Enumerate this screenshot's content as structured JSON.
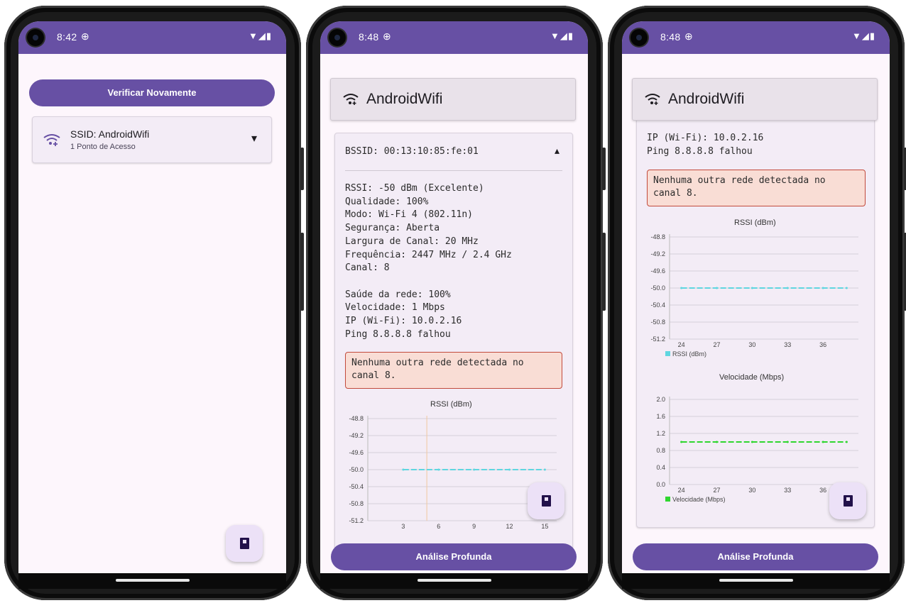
{
  "status": {
    "s1_time": "8:42",
    "s2_time": "8:48",
    "s3_time": "8:48",
    "sync_glyph": "⊕",
    "system_icons": "▼◢▮"
  },
  "screen1": {
    "check_again_label": "Verificar Novamente",
    "ssid_label": "SSID: AndroidWifi",
    "ap_count": "1 Ponto de Acesso",
    "expand_glyph": "▾"
  },
  "detail": {
    "network_name": "AndroidWifi",
    "bssid": "BSSID: 00:13:10:85:fe:01",
    "collapse_glyph": "▴",
    "rssi": "RSSI: -50 dBm (Excelente)",
    "quality": "Qualidade: 100%",
    "mode": "Modo: Wi-Fi 4 (802.11n)",
    "security": "Segurança: Aberta",
    "channel_width": "Largura de Canal: 20 MHz",
    "frequency": "Frequência: 2447 MHz / 2.4 GHz",
    "channel": "Canal: 8",
    "health": "Saúde da rede: 100%",
    "speed": "Velocidade: 1 Mbps",
    "ip": "IP (Wi-Fi): 10.0.2.16",
    "ping": "Ping 8.8.8.8 falhou",
    "alert_line1": "Nenhuma outra rede detectada no",
    "alert_line2": "canal 8.",
    "deep_analysis_label": "Análise Profunda"
  },
  "chart_data": [
    {
      "type": "line",
      "title": "RSSI (dBm)",
      "x": [
        3,
        6,
        9,
        12,
        15
      ],
      "x_ticks": [
        "3",
        "6",
        "9",
        "12",
        "15"
      ],
      "y_ticks": [
        "-48.8",
        "-49.2",
        "-49.6",
        "-50.0",
        "-50.4",
        "-50.8",
        "-51.2"
      ],
      "ylim": [
        -51.2,
        -48.8
      ],
      "series": [
        {
          "values": [
            -50.0,
            -50.0,
            -50.0,
            -50.0,
            -50.0
          ],
          "color": "#5fd6e0"
        }
      ],
      "marker_line_x": 5
    },
    {
      "type": "line",
      "title": "RSSI (dBm)",
      "x": [
        24,
        27,
        30,
        33,
        36,
        38
      ],
      "x_ticks": [
        "24",
        "27",
        "30",
        "33",
        "36"
      ],
      "y_ticks": [
        "-48.8",
        "-49.2",
        "-49.6",
        "-50.0",
        "-50.4",
        "-50.8",
        "-51.2"
      ],
      "ylim": [
        -51.2,
        -48.8
      ],
      "series": [
        {
          "name": "RSSI (dBm)",
          "values": [
            -50.0,
            -50.0,
            -50.0,
            -50.0,
            -50.0,
            -50.0
          ],
          "color": "#5fd6e0"
        }
      ]
    },
    {
      "type": "line",
      "title": "Velocidade (Mbps)",
      "x": [
        24,
        27,
        30,
        33,
        36,
        38
      ],
      "x_ticks": [
        "24",
        "27",
        "30",
        "33",
        "36"
      ],
      "y_ticks": [
        "2.0",
        "1.6",
        "1.2",
        "0.8",
        "0.4",
        "0.0"
      ],
      "ylim": [
        0.0,
        2.0
      ],
      "series": [
        {
          "name": "Velocidade (Mbps)",
          "values": [
            1.0,
            1.0,
            1.0,
            1.0,
            1.0,
            1.0
          ],
          "color": "#2fd62f"
        }
      ]
    }
  ],
  "colors": {
    "primary": "#6750a4",
    "background": "#fdf6fc",
    "alert_bg": "#f9ddd5",
    "alert_border": "#c24a3c",
    "rssi_line": "#5fd6e0",
    "speed_line": "#2fd62f"
  },
  "icons": {
    "wifi": "wifi-icon",
    "fab": "bookmark-icon"
  }
}
